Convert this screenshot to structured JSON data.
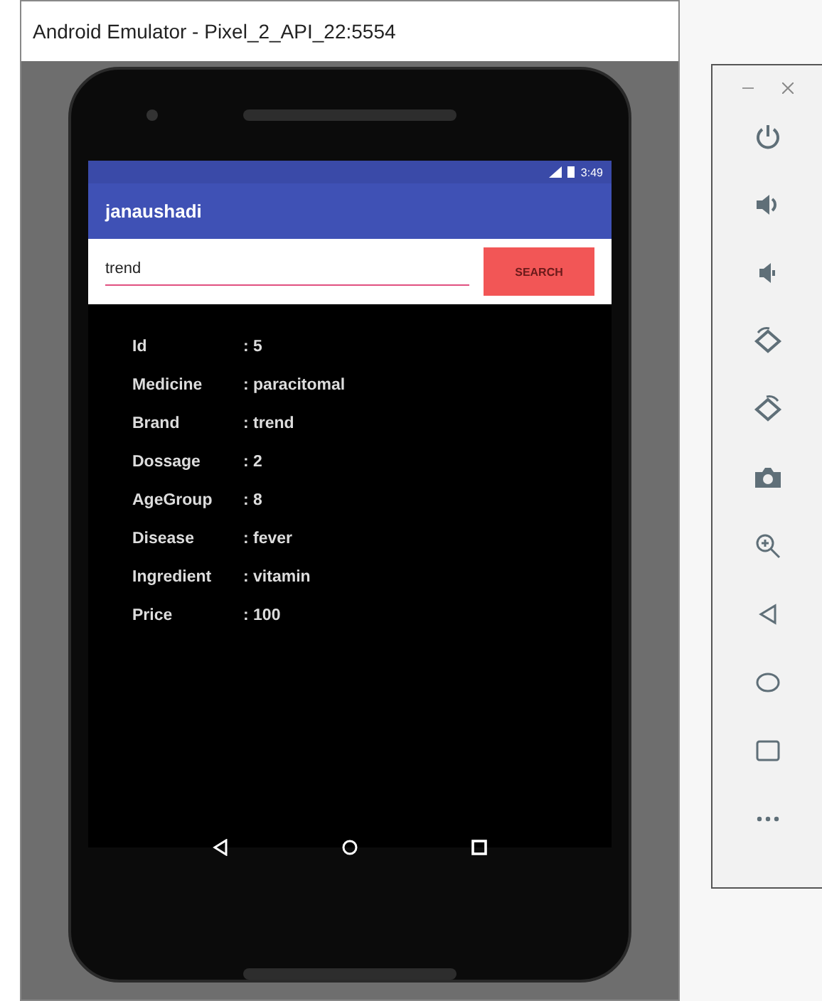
{
  "window": {
    "title": "Android Emulator - Pixel_2_API_22:5554"
  },
  "status_bar": {
    "time": "3:49"
  },
  "app_bar": {
    "title": "janaushadi"
  },
  "search": {
    "value": "trend",
    "button": "SEARCH"
  },
  "fields": [
    {
      "label": "Id",
      "value": ": 5"
    },
    {
      "label": "Medicine",
      "value": ": paracitomal"
    },
    {
      "label": "Brand",
      "value": ": trend"
    },
    {
      "label": "Dossage",
      "value": ": 2"
    },
    {
      "label": "AgeGroup",
      "value": ": 8"
    },
    {
      "label": "Disease",
      "value": ": fever"
    },
    {
      "label": "Ingredient",
      "value": ": vitamin"
    },
    {
      "label": "Price",
      "value": ": 100"
    }
  ],
  "toolbar": [
    {
      "kind": "power"
    },
    {
      "kind": "volume-up"
    },
    {
      "kind": "volume-down"
    },
    {
      "kind": "rotate-left"
    },
    {
      "kind": "rotate-right"
    },
    {
      "kind": "camera"
    },
    {
      "kind": "zoom"
    },
    {
      "kind": "back"
    },
    {
      "kind": "home"
    },
    {
      "kind": "overview"
    },
    {
      "kind": "more"
    }
  ]
}
